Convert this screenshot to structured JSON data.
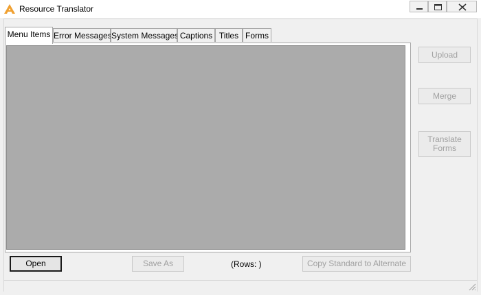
{
  "window": {
    "title": "Resource Translator"
  },
  "tabs": [
    {
      "label": "Menu Items",
      "active": true
    },
    {
      "label": "Error Messages",
      "active": false
    },
    {
      "label": "System Messages",
      "active": false
    },
    {
      "label": "Captions",
      "active": false
    },
    {
      "label": "Titles",
      "active": false
    },
    {
      "label": "Forms",
      "active": false
    }
  ],
  "side_buttons": {
    "upload": "Upload",
    "merge": "Merge",
    "translate_line1": "Translate",
    "translate_line2": "Forms"
  },
  "bottom": {
    "open": "Open",
    "save_as": "Save As",
    "rows": "(Rows: )",
    "copy": "Copy Standard to Alternate"
  },
  "colors": {
    "app_icon": "#f0a030",
    "grid_background": "#ababab"
  },
  "icons": {
    "app": "app-logo-icon",
    "minimize": "minimize-icon",
    "maximize": "maximize-icon",
    "close": "close-icon",
    "grip": "resize-grip-icon"
  }
}
